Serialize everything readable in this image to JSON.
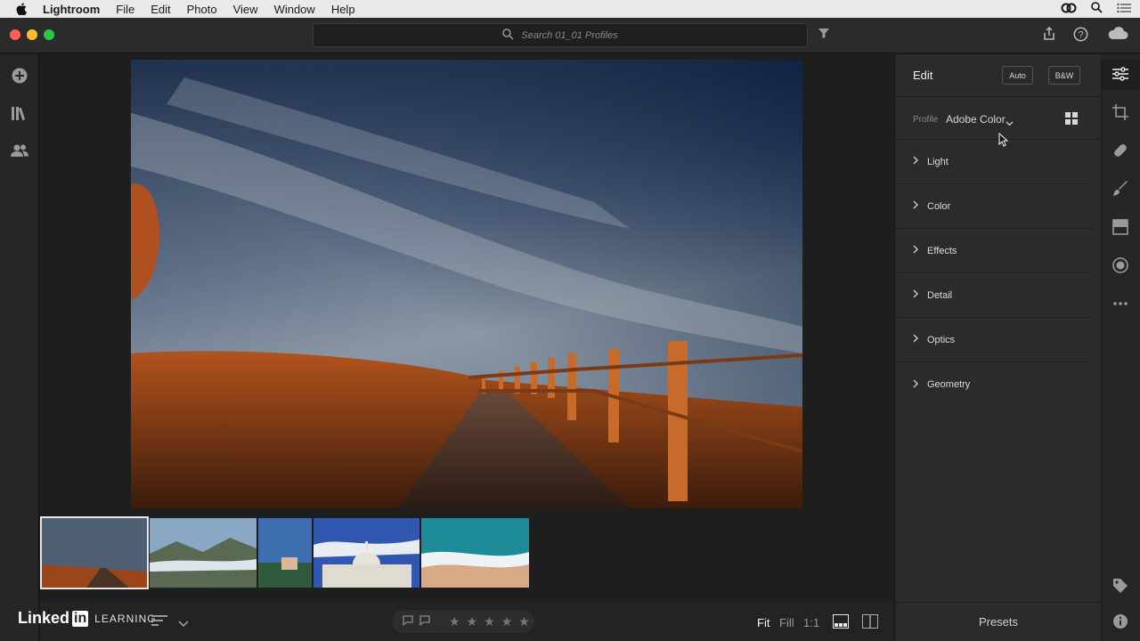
{
  "menubar": {
    "app_name": "Lightroom",
    "items": [
      "File",
      "Edit",
      "Photo",
      "View",
      "Window",
      "Help"
    ]
  },
  "toolbar": {
    "search_placeholder": "Search 01_01 Profiles"
  },
  "edit_panel": {
    "title": "Edit",
    "auto_label": "Auto",
    "bw_label": "B&W",
    "profile_label": "Profile",
    "profile_value": "Adobe Color",
    "sections": [
      "Light",
      "Color",
      "Effects",
      "Detail",
      "Optics",
      "Geometry"
    ],
    "presets_label": "Presets"
  },
  "bottom_bar": {
    "brand_linked": "Linked",
    "brand_in": "in",
    "brand_learning": "LEARNING",
    "zoom_fit": "Fit",
    "zoom_fill": "Fill",
    "zoom_one": "1:1"
  },
  "colors": {
    "accent": "#ffffff",
    "panel_bg": "#2b2b2b",
    "canvas_bg": "#1e1e1e"
  }
}
